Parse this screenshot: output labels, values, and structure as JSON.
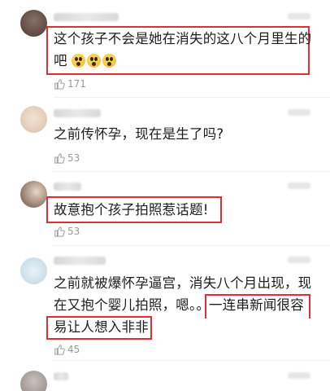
{
  "comments": [
    {
      "text_lines": [
        "这个孩子不会是她在消失的这八个月里生的",
        "吧"
      ],
      "emoji_count": 3,
      "likes": "171"
    },
    {
      "text_lines": [
        "之前传怀孕，现在是生了吗?"
      ],
      "likes": "53"
    },
    {
      "text_lines": [
        "故意抱个孩子拍照惹话题!"
      ],
      "likes": "53"
    },
    {
      "text_lines": [
        "之前就被爆怀孕逼宫，消失八个月出现，现",
        "在又抱个婴儿拍照，嗯。。",
        "一连串新闻很容",
        "易让人想入非非"
      ],
      "likes": "45"
    }
  ],
  "colors": {
    "highlight": "#e02e34",
    "muted": "#9a9a9a"
  },
  "icons": {
    "like": "thumbs-up-icon"
  }
}
